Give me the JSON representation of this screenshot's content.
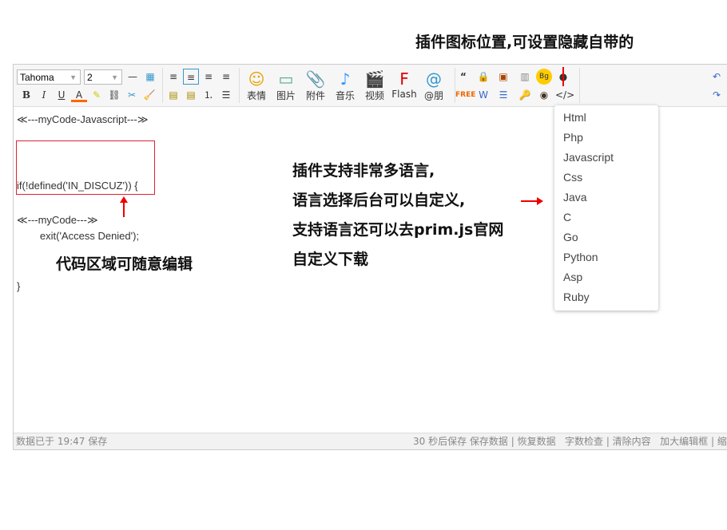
{
  "annotations": {
    "top": "插件图标位置,可设置隐藏自带的",
    "middle": [
      "插件支持非常多语言,",
      "语言选择后台可以自定义,",
      "支持语言还可以去prim.js官网",
      "自定义下载"
    ],
    "left": "代码区域可随意编辑"
  },
  "toolbar": {
    "font": "Tahoma",
    "size": "2",
    "media": [
      {
        "icon": "smiley-icon",
        "glyph": "☺",
        "label": "表情"
      },
      {
        "icon": "image-icon",
        "glyph": "▭",
        "label": "图片"
      },
      {
        "icon": "paperclip-icon",
        "glyph": "📎",
        "label": "附件"
      },
      {
        "icon": "music-icon",
        "glyph": "♪",
        "label": "音乐"
      },
      {
        "icon": "video-icon",
        "glyph": "🎬",
        "label": "视频"
      },
      {
        "icon": "flash-icon",
        "glyph": "F",
        "label": "Flash"
      },
      {
        "icon": "at-icon",
        "glyph": "@",
        "label": "@朋"
      }
    ],
    "code_glyph": "</>",
    "quote_glyph": "“"
  },
  "content": {
    "start_tag": "≪---myCode-Javascript---≫",
    "code": [
      "if(!defined('IN_DISCUZ')) {",
      "        exit('Access Denied');",
      "}"
    ],
    "end_tag": "≪---myCode---≫"
  },
  "status": {
    "left": "数据已于 19:47 保存",
    "right": "30 秒后保存 保存数据 | 恢复数据   字数检查 | 清除内容   加大编辑框 | 缩"
  },
  "languages": [
    "Html",
    "Php",
    "Javascript",
    "Css",
    "Java",
    "C",
    "Go",
    "Python",
    "Asp",
    "Ruby"
  ],
  "colors": {
    "accent": "#e00000",
    "selected": "#3399cc"
  }
}
